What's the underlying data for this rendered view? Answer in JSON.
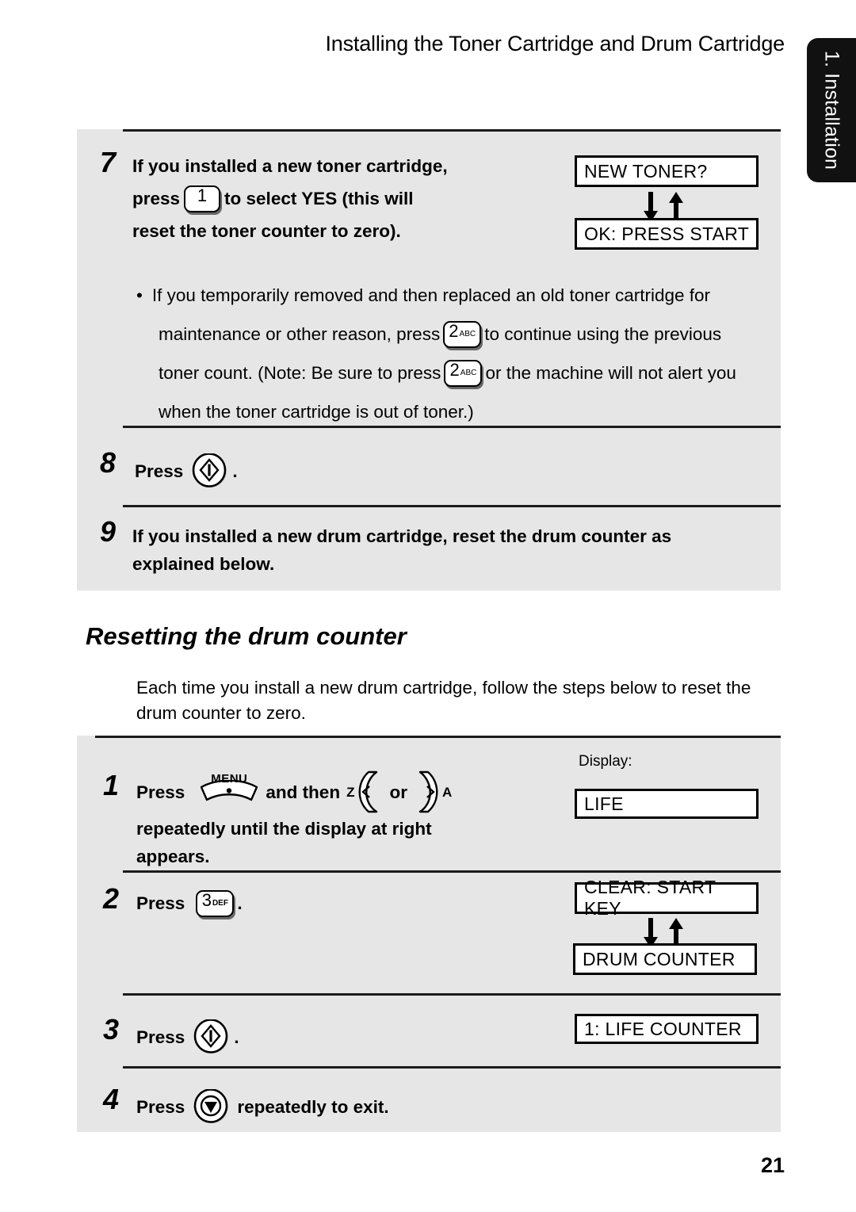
{
  "header": {
    "title": "Installing the Toner Cartridge and Drum Cartridge"
  },
  "side_tab": {
    "label": "1. Installation"
  },
  "page_number": "21",
  "section_top": {
    "steps": [
      {
        "number": "7",
        "line1": "If you installed a new toner cartridge,",
        "line2_pre": "press",
        "key": {
          "digit": "1",
          "sub": ""
        },
        "line2_post": "to select YES (this will",
        "line3": "reset the toner counter to zero)."
      },
      {
        "number": "8",
        "label": "Press",
        "button_icon": "start-button-icon",
        "trailing": "."
      },
      {
        "number": "9",
        "line1": "If you installed a new drum cartridge, reset the drum counter as",
        "line2": "explained below."
      }
    ],
    "bullet": {
      "marker": "•",
      "seg1": "If you temporarily removed and then replaced an old toner cartridge for",
      "seg2": "maintenance or other reason, press",
      "key_a": {
        "digit": "2",
        "sub": "ABC"
      },
      "seg3": "to continue using the previous",
      "seg4": "toner count. (Note: Be sure to press",
      "key_b": {
        "digit": "2",
        "sub": "ABC"
      },
      "seg5": "or the machine will not alert you",
      "seg6": "when the toner cartridge is out of toner.)"
    },
    "displays": [
      {
        "text": "NEW TONER?"
      },
      {
        "text": "OK: PRESS START"
      }
    ]
  },
  "section_bottom": {
    "heading": "Resetting the drum counter",
    "intro_line1": "Each time you install a new drum cartridge, follow the steps below to reset the",
    "intro_line2": "drum counter to zero.",
    "display_label": "Display:",
    "steps": [
      {
        "number": "1",
        "pre": "Press",
        "menu_key_label": "MENU",
        "mid": "and then",
        "left_letter": "Z",
        "or": "or",
        "right_letter": "A",
        "line2": "repeatedly until the display at right",
        "line3": "appears.",
        "display": "LIFE"
      },
      {
        "number": "2",
        "pre": "Press",
        "key": {
          "digit": "3",
          "sub": "DEF"
        },
        "trailing": ".",
        "display_top": "CLEAR: START KEY",
        "display_bottom": "DRUM COUNTER"
      },
      {
        "number": "3",
        "pre": "Press",
        "button_icon": "start-button-icon",
        "trailing": ".",
        "display": "1: LIFE COUNTER"
      },
      {
        "number": "4",
        "pre": "Press",
        "button_icon": "stop-button-icon",
        "post": "repeatedly to exit."
      }
    ]
  },
  "colors": {
    "panel_bg": "#e6e6e6",
    "tab_bg": "#111111",
    "ink": "#000000",
    "paper": "#ffffff"
  }
}
